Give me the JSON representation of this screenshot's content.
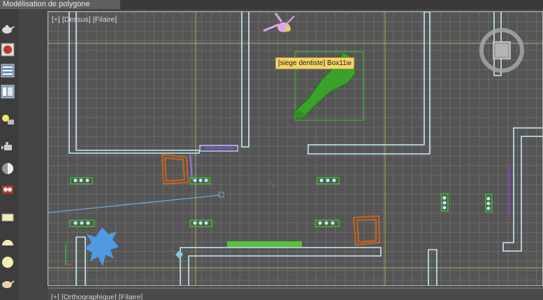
{
  "ribbon": {
    "active_tab": "Modélisation de polygone"
  },
  "viewport_top": {
    "menu_plus": "[+]",
    "view_name": "[Dessus]",
    "shading": "[Filaire]"
  },
  "viewport_bottom": {
    "menu_plus": "[+]",
    "view_name": "[Orthographique]",
    "shading": "[Filaire]"
  },
  "tooltip": {
    "text": "[siege dentiste] Box11w"
  },
  "colors": {
    "grid_bg": "#555555",
    "grid_line": "#6b6b6b",
    "walls": "#bfeef4",
    "selection": "#39c91f",
    "orange": "#c7641f",
    "blue_plant": "#4f9be3",
    "tooltip_bg": "#f6d468"
  },
  "left_toolbar_icons": [
    "teapot-icon",
    "material-editor-icon",
    "layer-manager-icon",
    "scene-explorer-icon",
    "light-icon",
    "camera-icon",
    "sphere-shaded-icon",
    "render-icon",
    "box-primitive-icon",
    "half-sphere-icon",
    "sphere-icon",
    "teapot-small-icon"
  ]
}
